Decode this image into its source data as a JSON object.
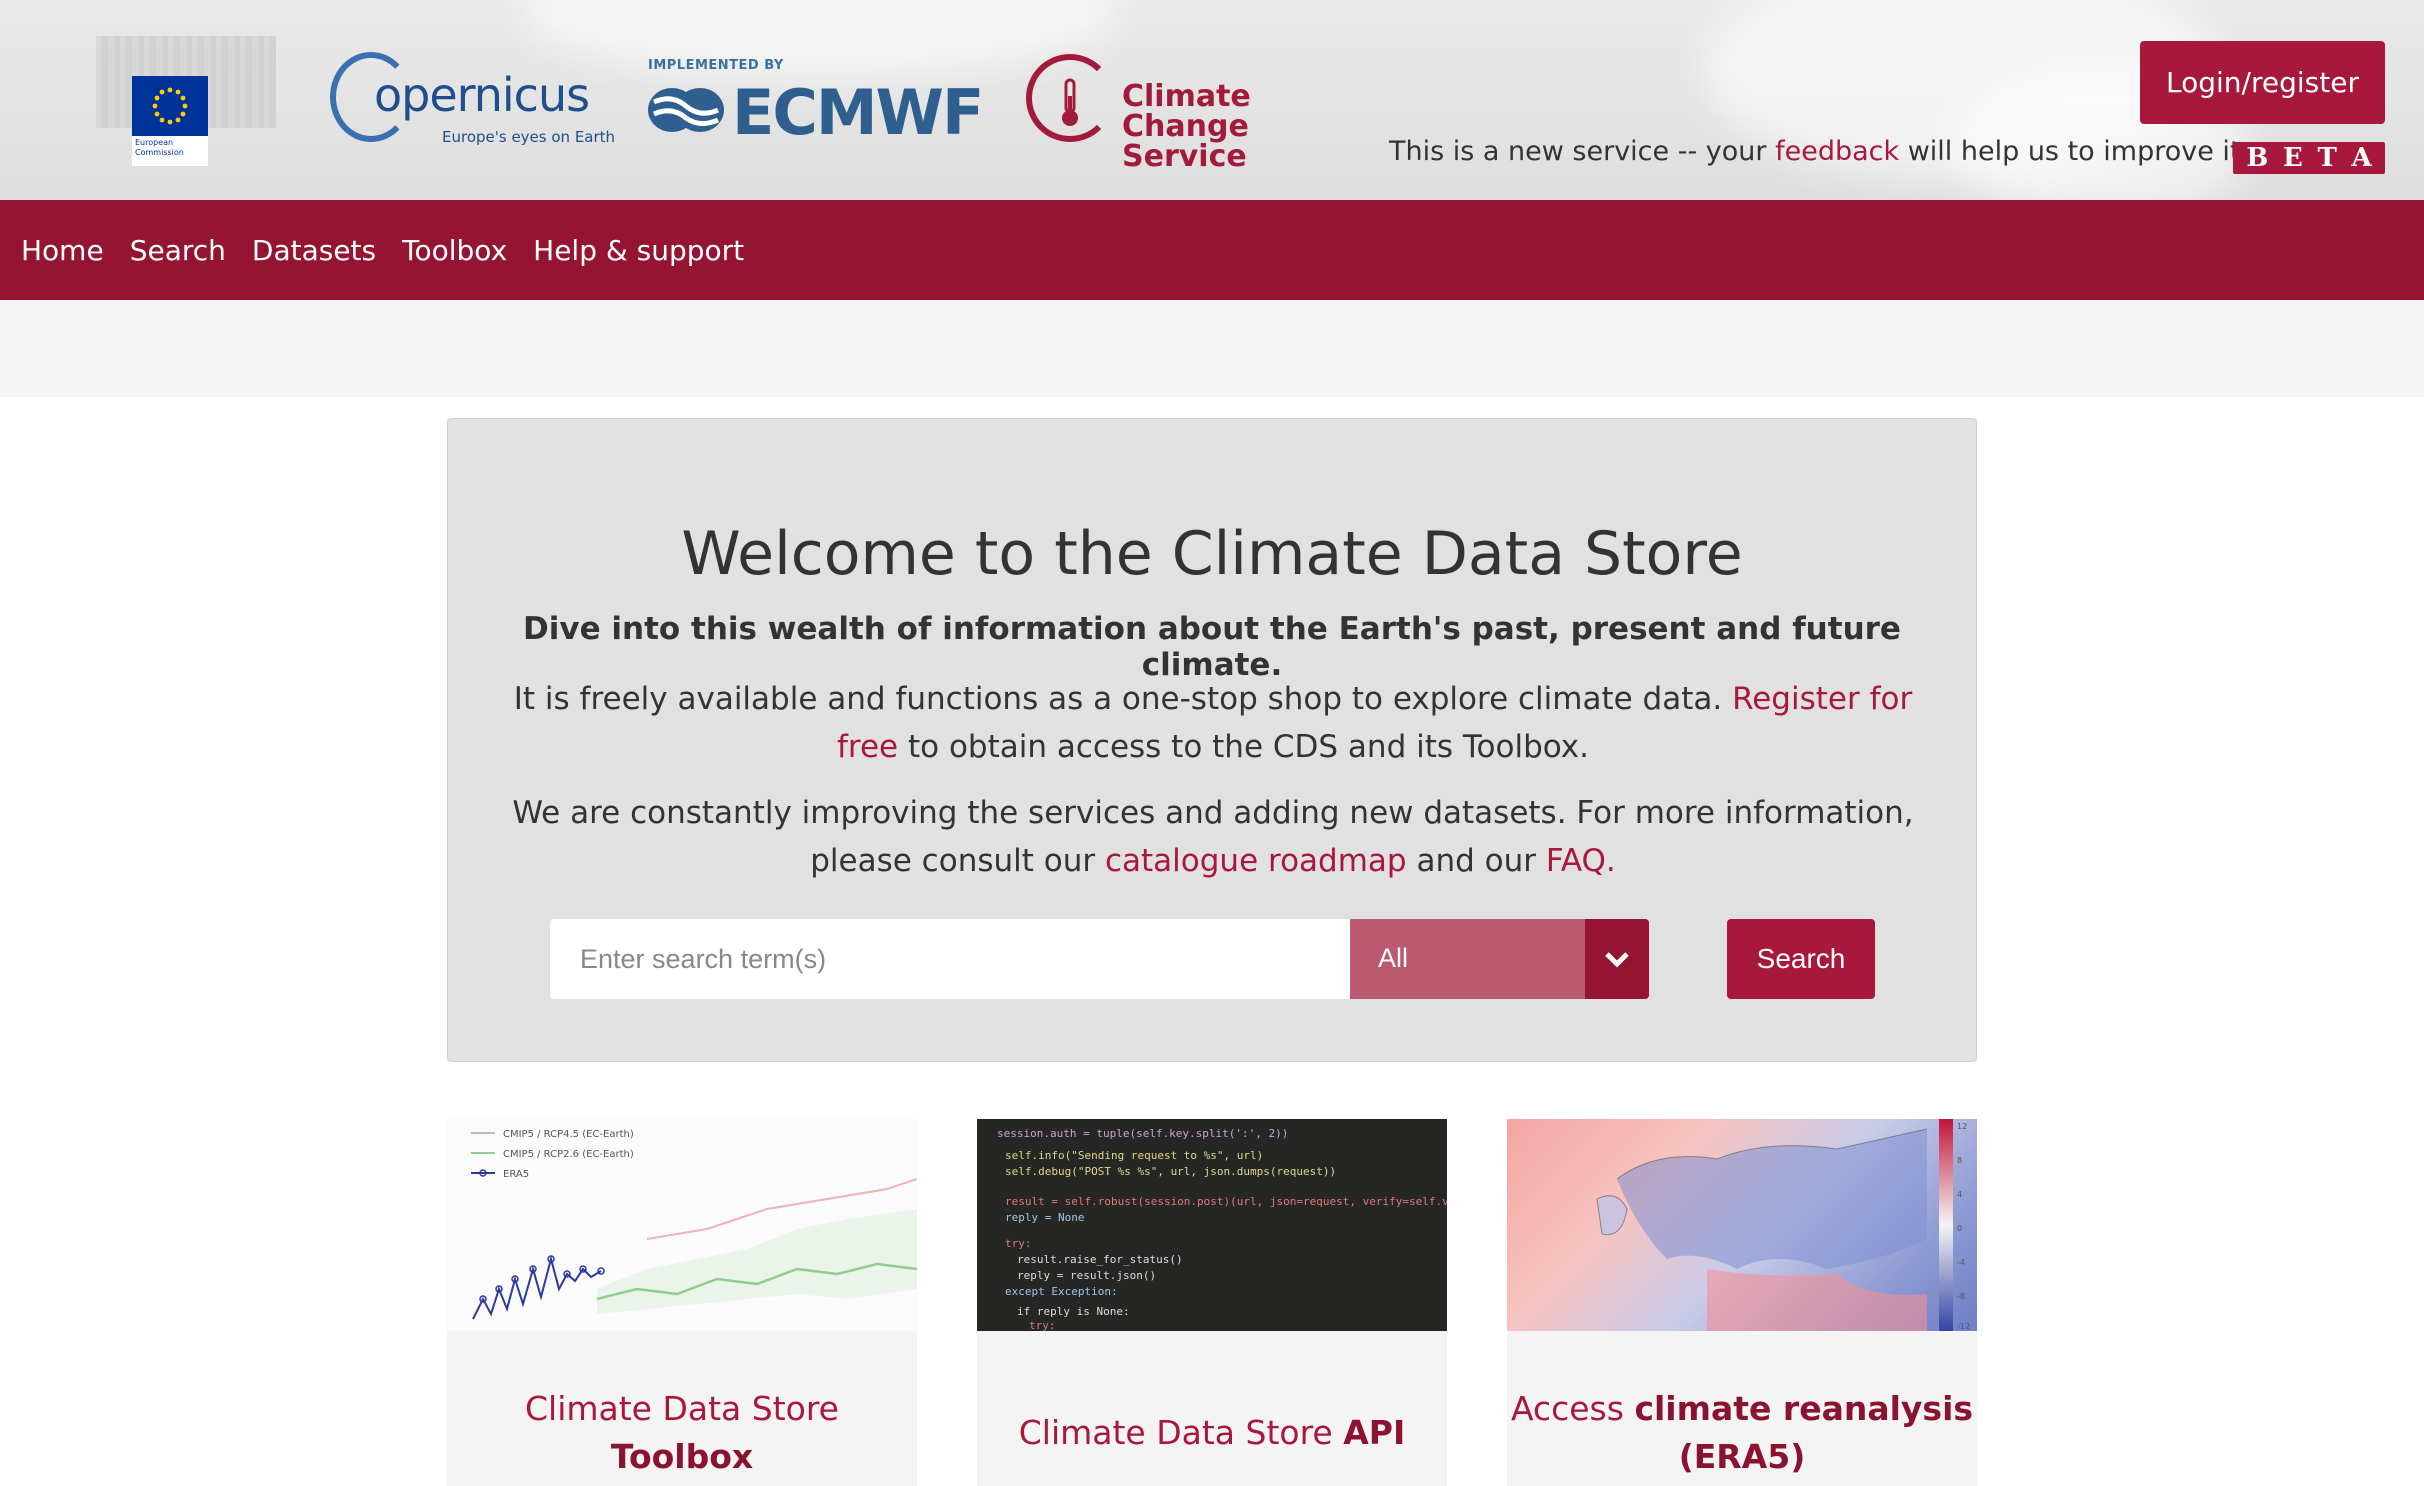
{
  "header": {
    "ec_logo_text": "European Commission",
    "copernicus_word": "opernicus",
    "copernicus_tagline": "Europe's eyes on Earth",
    "ecmwf_implemented_by": "IMPLEMENTED BY",
    "ecmwf_word": "ECMWF",
    "ccs_line1": "Climate Change",
    "ccs_line2": "Service",
    "login_label": "Login/register",
    "beta_note_prefix": "This is a new service -- your ",
    "beta_note_link": "feedback",
    "beta_note_suffix": " will help us to improve it",
    "beta_letters": [
      "B",
      "E",
      "T",
      "A"
    ]
  },
  "nav": {
    "items": [
      "Home",
      "Search",
      "Datasets",
      "Toolbox",
      "Help & support"
    ]
  },
  "hero": {
    "title": "Welcome to the Climate Data Store",
    "lead": "Dive into this wealth of information about the Earth's past, present and future climate.",
    "p1_text": "It is freely available and functions  as a one-stop shop to explore climate data. ",
    "p1_link": "Register for free",
    "p1_suffix": " to obtain access to the CDS and its Toolbox.",
    "p2_text": "We are constantly improving the services and adding new datasets. For more information, please consult our ",
    "p2_link1": "catalogue roadmap",
    "p2_mid": " and our ",
    "p2_link2": "FAQ.",
    "search_placeholder": "Enter search term(s)",
    "search_value": "",
    "select_value": "All",
    "search_button": "Search"
  },
  "cards": [
    {
      "title_plain": "Climate Data Store ",
      "title_bold": "Toolbox",
      "thumb_legend": [
        "CMIP5 / RCP4.5 (EC-Earth)",
        "CMIP5 / RCP2.6 (EC-Earth)",
        "ERA5"
      ]
    },
    {
      "title_plain": "Climate Data Store ",
      "title_bold": "API"
    },
    {
      "title_plain": "Access ",
      "title_bold": "climate reanalysis (ERA5)",
      "thumb_scale": [
        "12",
        "8",
        "4",
        "0",
        "-4",
        "-8",
        "-12"
      ]
    }
  ],
  "colors": {
    "brand": "#a7183c",
    "nav_bg": "#951431",
    "hero_bg": "#e1e1e1"
  }
}
